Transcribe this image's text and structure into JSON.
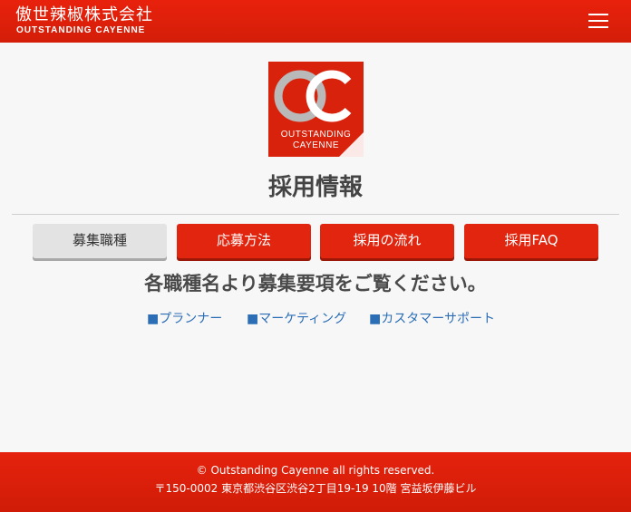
{
  "header": {
    "brand_jp": "傲世辣椒株式会社",
    "brand_en": "OUTSTANDING CAYENNE",
    "menu_icon": "hamburger-menu-icon",
    "background_color": "#e2210c"
  },
  "logo": {
    "line1": "OUTSTANDING",
    "line2": "CAYENNE",
    "background_color": "#d8220c"
  },
  "page_title": "採用情報",
  "tabs": [
    {
      "label": "募集職種",
      "state": "active",
      "color": "#e3e3e3"
    },
    {
      "label": "応募方法",
      "state": "default",
      "color": "#e2250f"
    },
    {
      "label": "採用の流れ",
      "state": "default",
      "color": "#e2250f"
    },
    {
      "label": "採用FAQ",
      "state": "default",
      "color": "#e2250f"
    }
  ],
  "intro_text": "各職種名より募集要項をご覧ください。",
  "job_links": [
    {
      "label": "■プランナー"
    },
    {
      "label": "■マーケティング"
    },
    {
      "label": "■カスタマーサポート"
    }
  ],
  "link_color": "#2b6eb5",
  "footer": {
    "copyright": "© Outstanding Cayenne all rights reserved.",
    "address": "〒150-0002 東京都渋谷区渋谷2丁目19-19 10階 宮益坂伊藤ビル"
  }
}
